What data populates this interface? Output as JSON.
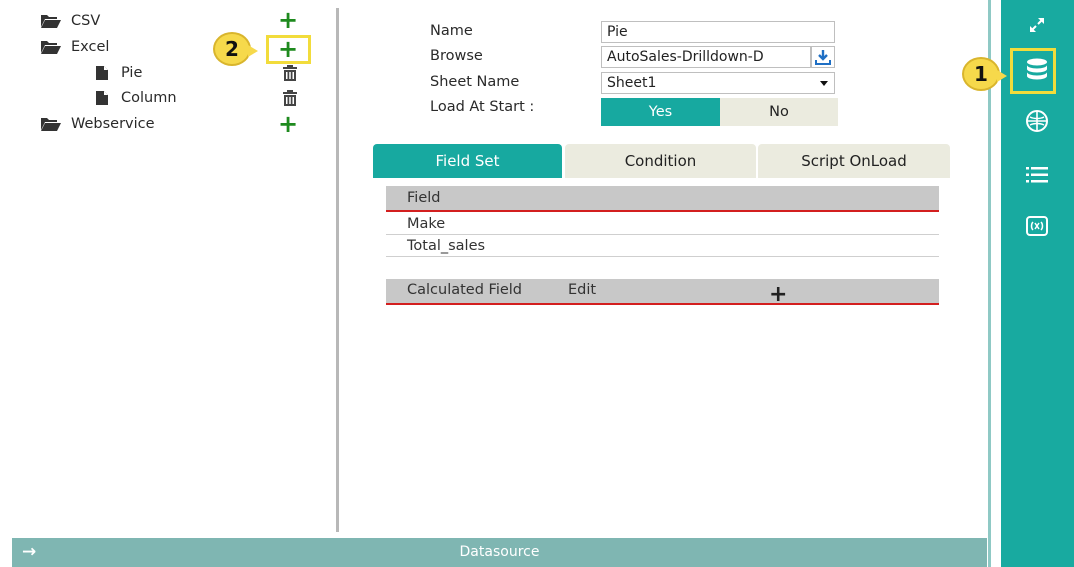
{
  "tree": {
    "items": [
      {
        "label": "CSV",
        "type": "folder",
        "action": "add"
      },
      {
        "label": "Excel",
        "type": "folder",
        "action": "add"
      },
      {
        "label": "Pie",
        "type": "file",
        "action": "delete"
      },
      {
        "label": "Column",
        "type": "file",
        "action": "delete"
      },
      {
        "label": "Webservice",
        "type": "folder",
        "action": "add"
      }
    ]
  },
  "callouts": {
    "one": "1",
    "two": "2"
  },
  "form": {
    "name_label": "Name",
    "name_value": "Pie",
    "browse_label": "Browse",
    "browse_value": "AutoSales-Drilldown-D",
    "sheet_label": "Sheet Name",
    "sheet_value": "Sheet1",
    "load_label": "Load At Start :",
    "yes_label": "Yes",
    "no_label": "No",
    "load_selected": "Yes"
  },
  "tabs": [
    {
      "label": "Field Set",
      "active": true
    },
    {
      "label": "Condition",
      "active": false
    },
    {
      "label": "Script OnLoad",
      "active": false
    }
  ],
  "field_table": {
    "header": "Field",
    "rows": [
      "Make",
      "Total_sales"
    ]
  },
  "calc_table": {
    "header": "Calculated Field",
    "edit_label": "Edit",
    "add_symbol": "+"
  },
  "bottom_bar": {
    "arrow": "→",
    "title": "Datasource"
  },
  "sidebar": {
    "icons": [
      "expand-icon",
      "database-icon",
      "globe-chart-icon",
      "list-icon",
      "formula-icon"
    ],
    "active": "database-icon"
  },
  "colors": {
    "accent": "#17a9a0",
    "tab_inactive": "#ebebdf",
    "add_green": "#1e8a1e",
    "highlight_yellow": "#f2dc3b",
    "underline_red": "#d31f1f",
    "bottom_bar": "#7fb6b2"
  }
}
